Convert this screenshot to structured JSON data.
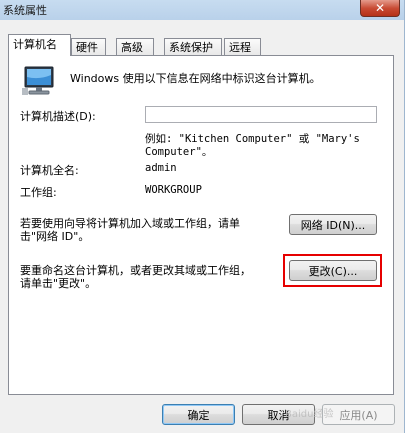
{
  "window": {
    "title": "系统属性",
    "close_symbol": "✕"
  },
  "tabs": [
    {
      "label": "计算机名",
      "active": true
    },
    {
      "label": "硬件"
    },
    {
      "label": "高级"
    },
    {
      "label": "系统保护"
    },
    {
      "label": "远程"
    }
  ],
  "panel": {
    "intro_text": "Windows 使用以下信息在网络中标识这台计算机。",
    "description_label": "计算机描述(D):",
    "description_value": "",
    "example_line1": "例如: \"Kitchen Computer\" 或 \"Mary's",
    "example_line2": "Computer\"。",
    "fullname_label": "计算机全名:",
    "fullname_value": "admin",
    "workgroup_label": "工作组:",
    "workgroup_value": "WORKGROUP",
    "wizard_text_line1": "若要使用向导将计算机加入域或工作组，请单",
    "wizard_text_line2": "击\"网络 ID\"。",
    "network_id_button": "网络 ID(N)...",
    "rename_text_line1": "要重命名这台计算机，或者更改其域或工作组，",
    "rename_text_line2": "请单击\"更改\"。",
    "change_button": "更改(C)..."
  },
  "footer": {
    "ok_button": "确定",
    "cancel_button": "取消",
    "apply_button": "应用(A)"
  },
  "watermark": "Baidu经验",
  "colors": {
    "highlight": "#e60000"
  }
}
